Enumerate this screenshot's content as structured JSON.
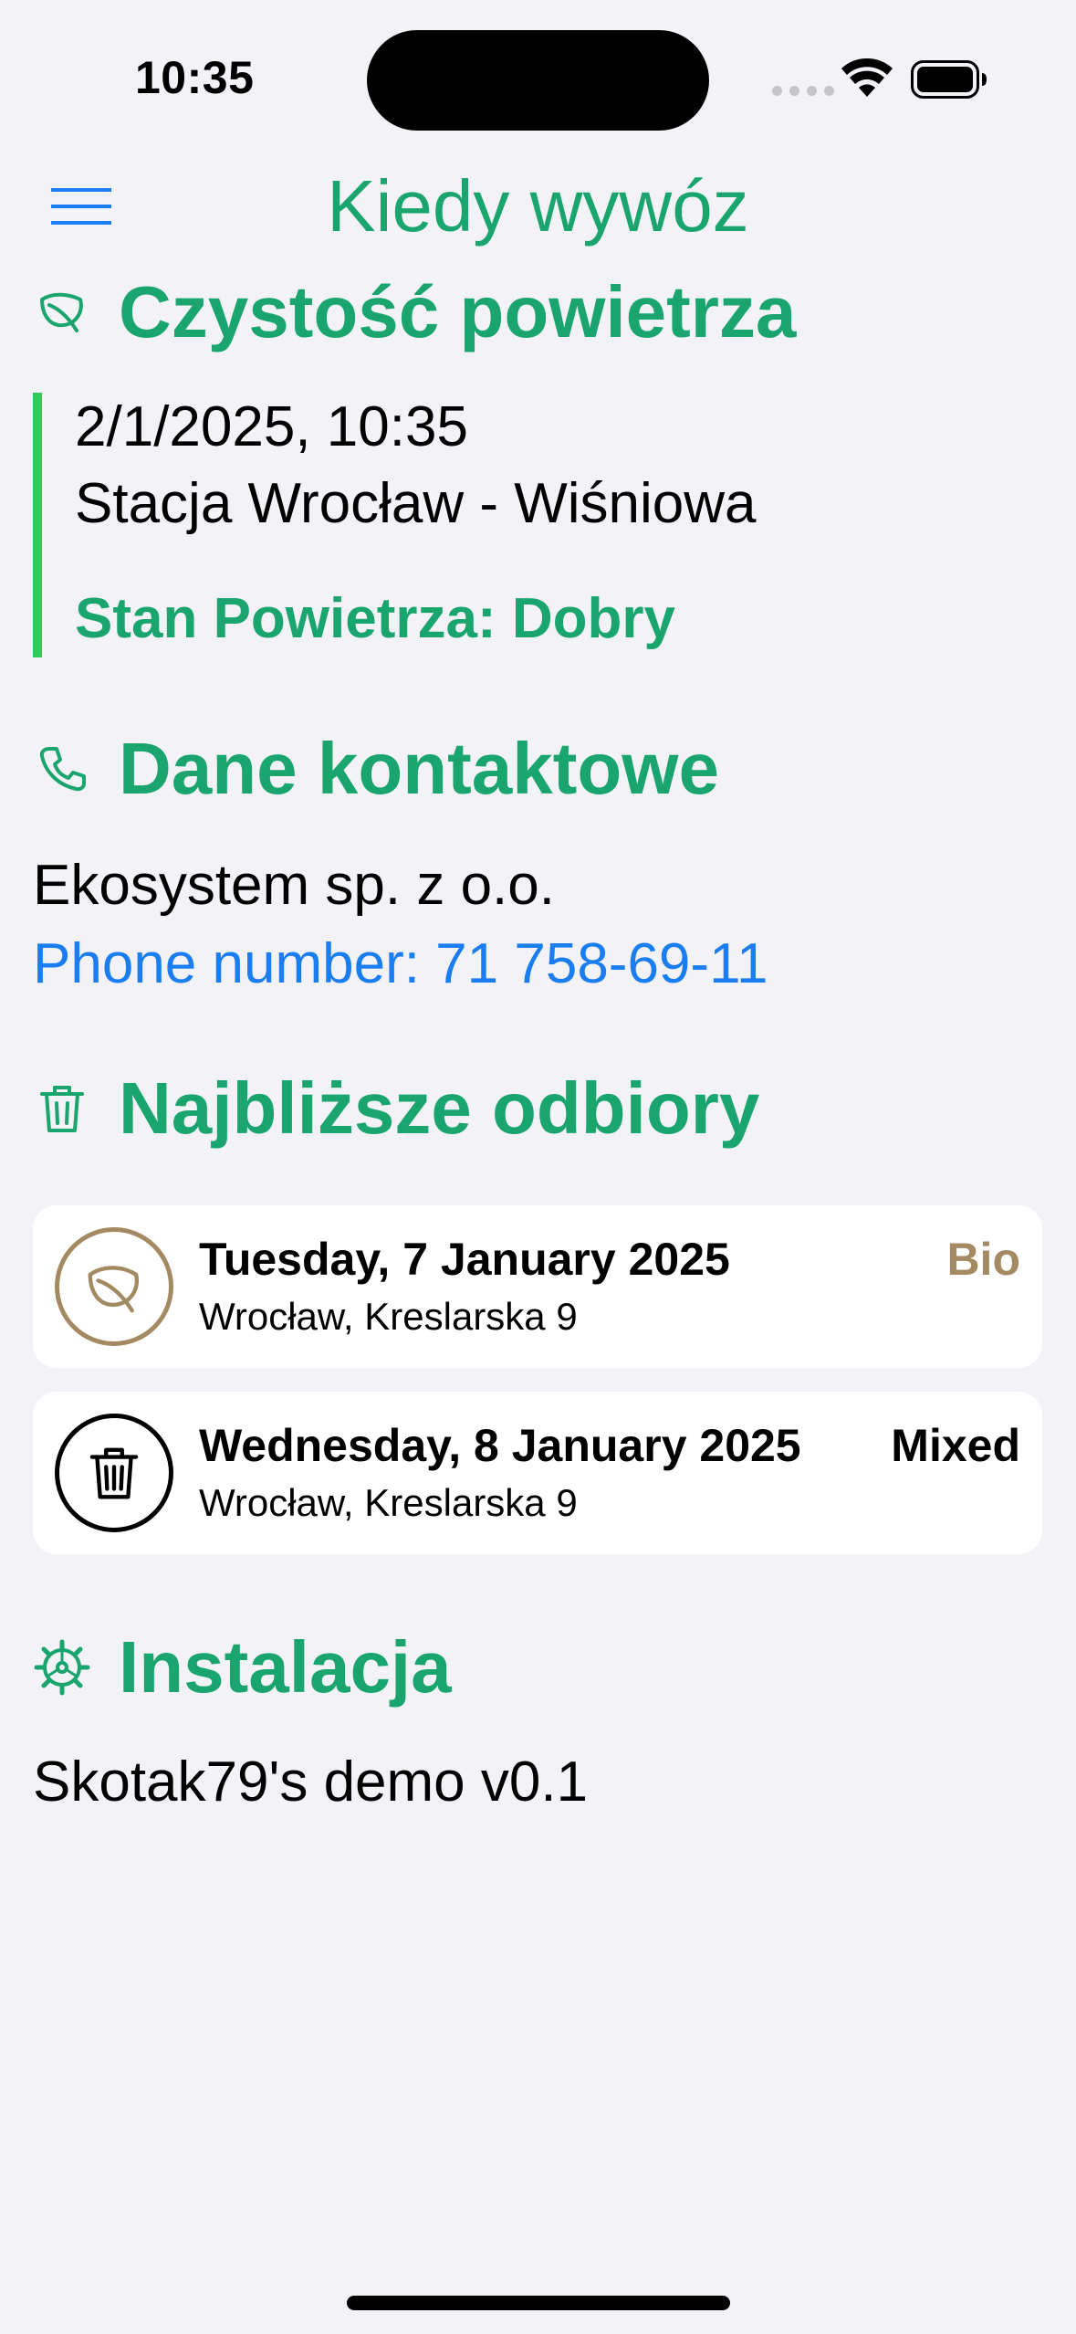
{
  "status_bar": {
    "time": "10:35"
  },
  "nav": {
    "title": "Kiedy wywóz",
    "menu_icon": "hamburger-menu-icon"
  },
  "air_quality": {
    "heading": "Czystość powietrza",
    "icon": "leaf-icon",
    "datetime": "2/1/2025, 10:35",
    "station": "Stacja Wrocław - Wiśniowa",
    "status": "Stan Powietrza: Dobry",
    "accent_color": "#34c759"
  },
  "contact": {
    "heading": "Dane kontaktowe",
    "icon": "phone-icon",
    "company": "Ekosystem sp. z o.o.",
    "phone_link": "Phone number: 71 758-69-11",
    "link_color": "#1a7df2"
  },
  "pickups": {
    "heading": "Najbliższe odbiory",
    "icon": "trash-icon",
    "items": [
      {
        "date": "Tuesday, 7 January 2025",
        "address": "Wrocław, Kreslarska 9",
        "type": "Bio",
        "icon": "leaf-icon",
        "color": "#a48a62"
      },
      {
        "date": "Wednesday, 8 January 2025",
        "address": "Wrocław, Kreslarska 9",
        "type": "Mixed",
        "icon": "trash-icon",
        "color": "#000000"
      }
    ]
  },
  "installation": {
    "heading": "Instalacja",
    "icon": "gear-icon",
    "version": "Skotak79's demo v0.1"
  },
  "theme": {
    "brand_color": "#19a56d",
    "background": "#f2f2f7"
  }
}
